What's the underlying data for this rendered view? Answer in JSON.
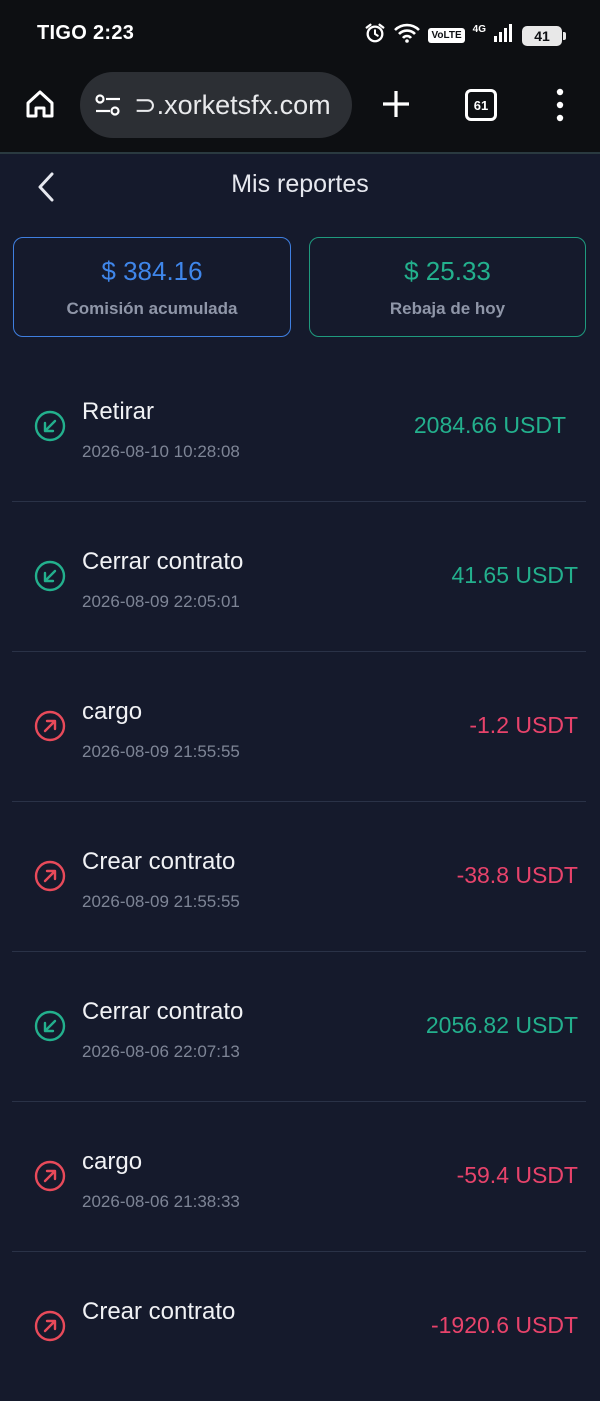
{
  "status_bar": {
    "carrier_time": "TIGO 2:23",
    "volte": "VoLTE",
    "network": "4G",
    "battery": "41",
    "icons": [
      "alarm-icon",
      "wifi-icon",
      "signal-icon",
      "battery-icon"
    ]
  },
  "browser": {
    "url": "⊃.xorketsfx.com",
    "tab_count": "61",
    "icons": [
      "home-icon",
      "site-settings-icon",
      "plus-icon",
      "tabs-icon",
      "more-vert-icon"
    ]
  },
  "header": {
    "title": "Mis reportes"
  },
  "summary": {
    "commission": {
      "value": "$ 384.16",
      "label": "Comisión acumulada"
    },
    "rebate": {
      "value": "$ 25.33",
      "label": "Rebaja de hoy"
    }
  },
  "transactions": [
    {
      "title": "Retirar",
      "time": "2026-08-10 10:28:08",
      "amount": "2084.66 USDT",
      "direction": "in"
    },
    {
      "title": "Cerrar contrato",
      "time": "2026-08-09 22:05:01",
      "amount": "41.65 USDT",
      "direction": "in"
    },
    {
      "title": "cargo",
      "time": "2026-08-09 21:55:55",
      "amount": "-1.2 USDT",
      "direction": "out"
    },
    {
      "title": "Crear contrato",
      "time": "2026-08-09 21:55:55",
      "amount": "-38.8 USDT",
      "direction": "out"
    },
    {
      "title": "Cerrar contrato",
      "time": "2026-08-06 22:07:13",
      "amount": "2056.82 USDT",
      "direction": "in"
    },
    {
      "title": "cargo",
      "time": "2026-08-06 21:38:33",
      "amount": "-59.4 USDT",
      "direction": "out"
    },
    {
      "title": "Crear contrato",
      "time": "",
      "amount": "-1920.6 USDT",
      "direction": "out"
    }
  ],
  "colors": {
    "background": "#151a2c",
    "positive": "#23b08d",
    "negative": "#e8436b",
    "accent_blue": "#3f86ea"
  }
}
